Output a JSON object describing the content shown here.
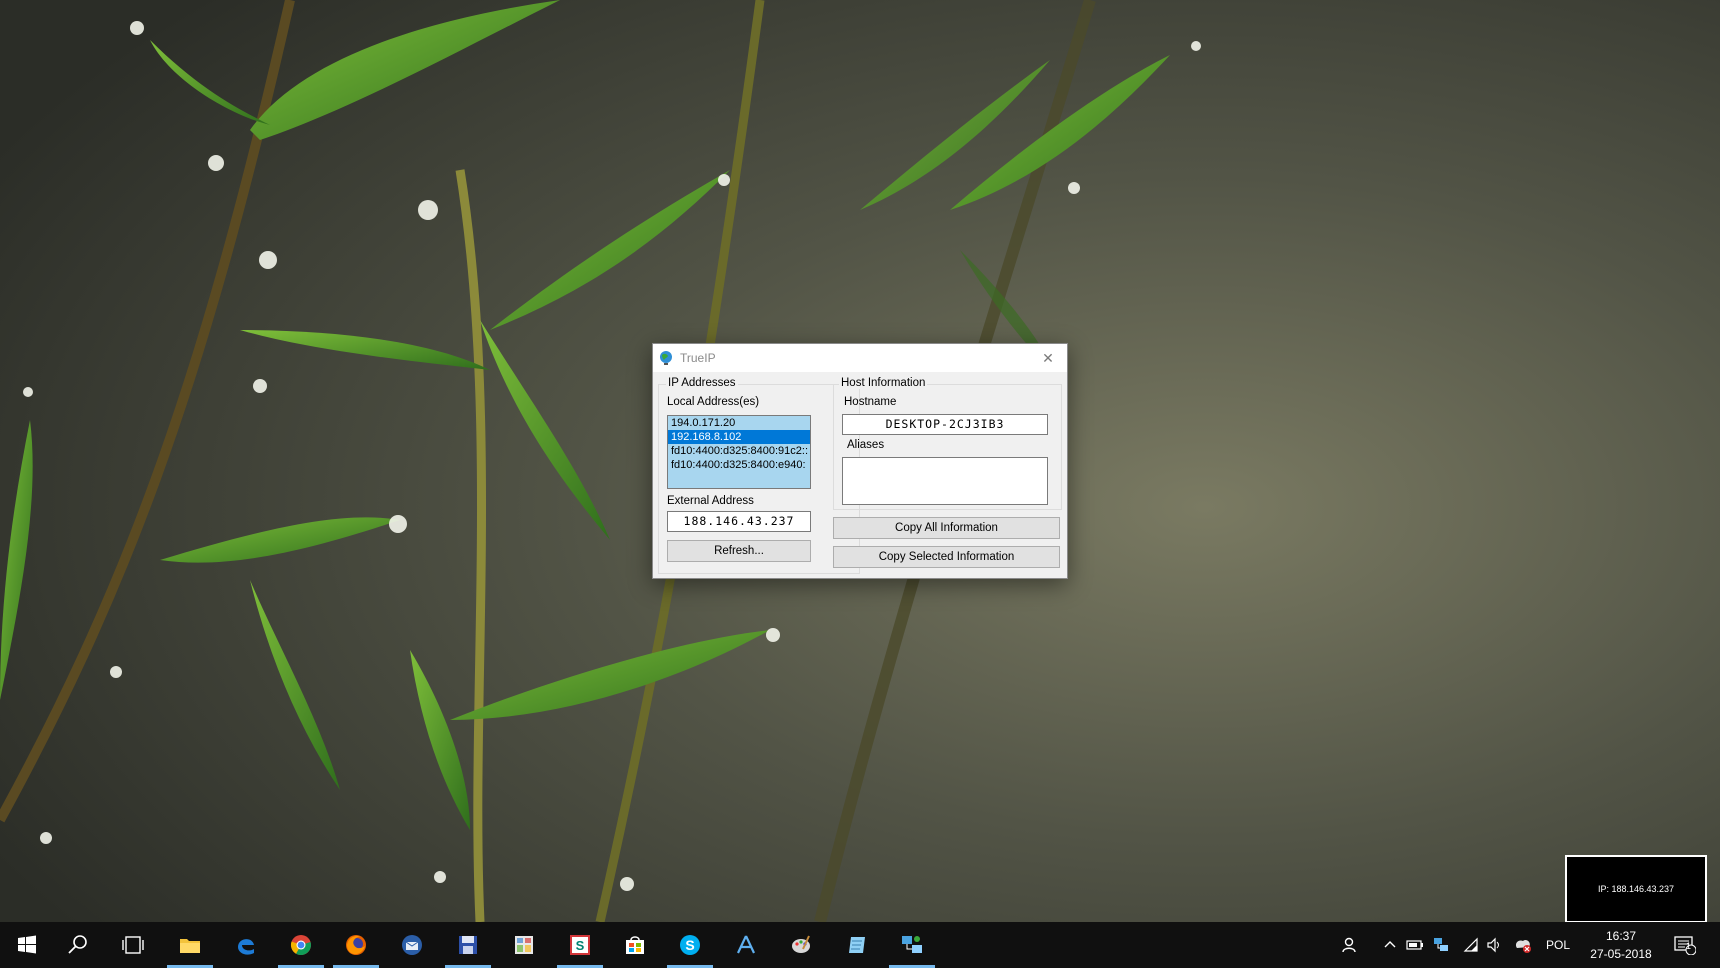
{
  "window": {
    "title": "TrueIP",
    "close_symbol": "✕"
  },
  "ip_addresses": {
    "group_label": "IP Addresses",
    "local_label": "Local Address(es)",
    "local_items": [
      {
        "text": "194.0.171.20",
        "selected": false
      },
      {
        "text": "192.168.8.102",
        "selected": true
      },
      {
        "text": "fd10:4400:d325:8400:91c2::",
        "selected": false
      },
      {
        "text": "fd10:4400:d325:8400:e940:",
        "selected": false
      }
    ],
    "external_label": "External Address",
    "external_value": "188.146.43.237",
    "refresh_label": "Refresh..."
  },
  "host_info": {
    "group_label": "Host Information",
    "hostname_label": "Hostname",
    "hostname_value": "DESKTOP-2CJ3IB3",
    "aliases_label": "Aliases",
    "aliases_value": ""
  },
  "buttons": {
    "copy_all": "Copy All Information",
    "copy_selected": "Copy Selected Information"
  },
  "ip_widget": {
    "text": "IP: 188.146.43.237"
  },
  "taskbar": {
    "apps": [
      {
        "name": "start-icon",
        "running": false
      },
      {
        "name": "search-icon",
        "running": false
      },
      {
        "name": "task-view-icon",
        "running": false
      },
      {
        "name": "file-explorer-icon",
        "running": true
      },
      {
        "name": "edge-icon",
        "running": false
      },
      {
        "name": "chrome-icon",
        "running": true
      },
      {
        "name": "firefox-icon",
        "running": true
      },
      {
        "name": "thunderbird-icon",
        "running": false
      },
      {
        "name": "floppy-save-icon",
        "running": true
      },
      {
        "name": "calculator-app-icon",
        "running": false
      },
      {
        "name": "sway-icon",
        "running": true
      },
      {
        "name": "store-icon",
        "running": false
      },
      {
        "name": "skype-icon",
        "running": true
      },
      {
        "name": "app-store-icon",
        "running": false
      },
      {
        "name": "paint-icon",
        "running": false
      },
      {
        "name": "notepad-icon",
        "running": false
      },
      {
        "name": "network-tool-icon",
        "running": true
      }
    ],
    "tray": {
      "language": "POL",
      "time": "16:37",
      "date": "27-05-2018",
      "notifications_count": "1"
    }
  },
  "colors": {
    "selection": "#0078d7",
    "listbox_bg": "#a8d6ef",
    "taskbar_bg": "#101010",
    "running_indicator": "#76b9ed"
  }
}
